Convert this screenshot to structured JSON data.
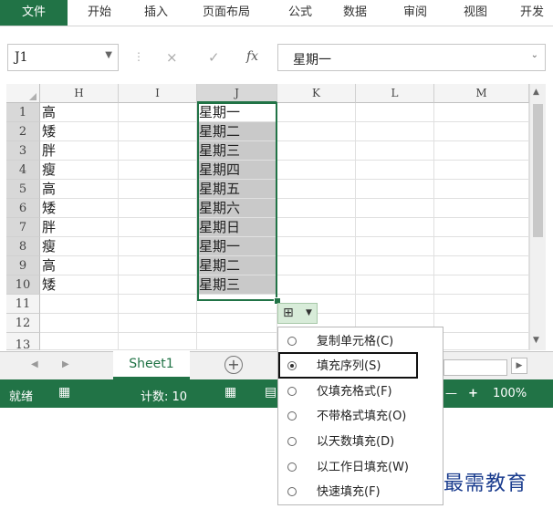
{
  "ribbon": {
    "tabs": [
      {
        "label": "文件",
        "active": true
      },
      {
        "label": "开始"
      },
      {
        "label": "插入"
      },
      {
        "label": "页面布局"
      },
      {
        "label": "公式"
      },
      {
        "label": "数据"
      },
      {
        "label": "审阅"
      },
      {
        "label": "视图"
      },
      {
        "label": "开发"
      }
    ]
  },
  "formula_bar": {
    "name_box": "J1",
    "cancel_icon": "×",
    "enter_icon": "✓",
    "fx_label": "fx",
    "content": "星期一"
  },
  "grid": {
    "columns": [
      "H",
      "I",
      "J",
      "K",
      "L",
      "M"
    ],
    "rows": [
      "1",
      "2",
      "3",
      "4",
      "5",
      "6",
      "7",
      "8",
      "9",
      "10",
      "11",
      "12",
      "13"
    ],
    "column_h": [
      "高",
      "矮",
      "胖",
      "瘦",
      "高",
      "矮",
      "胖",
      "瘦",
      "高",
      "矮"
    ],
    "column_j": [
      "星期一",
      "星期二",
      "星期三",
      "星期四",
      "星期五",
      "星期六",
      "星期日",
      "星期一",
      "星期二",
      "星期三"
    ]
  },
  "sheet_tabs": {
    "active": "Sheet1",
    "add_icon": "+"
  },
  "status_bar": {
    "ready": "就绪",
    "count": "计数: 10",
    "zoom": "100%",
    "zoom_minus": "—",
    "zoom_plus": "+"
  },
  "autofill_menu": {
    "items": [
      {
        "label": "复制单元格(C)",
        "selected": false
      },
      {
        "label": "填充序列(S)",
        "selected": true
      },
      {
        "label": "仅填充格式(F)",
        "selected": false
      },
      {
        "label": "不带格式填充(O)",
        "selected": false
      },
      {
        "label": "以天数填充(D)",
        "selected": false
      },
      {
        "label": "以工作日填充(W)",
        "selected": false
      },
      {
        "label": "快速填充(F)",
        "selected": false
      }
    ]
  },
  "watermark": "最需教育",
  "colors": {
    "accent": "#217346",
    "selection_fill": "#c9c9c9",
    "watermark": "#1a3c8e"
  }
}
